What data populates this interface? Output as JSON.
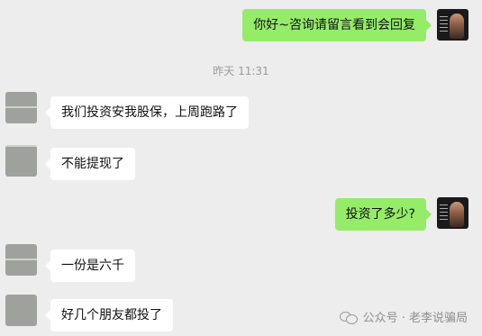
{
  "messages": [
    {
      "side": "self",
      "text": "你好~咨询请留言看到会回复"
    },
    {
      "side": "other",
      "text": "我们投资安我股保，上周跑路了"
    },
    {
      "side": "other",
      "text": "不能提现了"
    },
    {
      "side": "self",
      "text": "投资了多少?"
    },
    {
      "side": "other",
      "text": "一份是六千"
    },
    {
      "side": "other",
      "text": "好几个朋友都投了"
    }
  ],
  "timestamp": "昨天 11:31",
  "watermark": {
    "text": "公众号 · 老李说骗局",
    "icon": "wechat-logo-icon"
  },
  "colors": {
    "background": "#ededed",
    "self_bubble": "#95ec69",
    "other_bubble": "#ffffff",
    "timestamp": "#9a9a9a"
  }
}
